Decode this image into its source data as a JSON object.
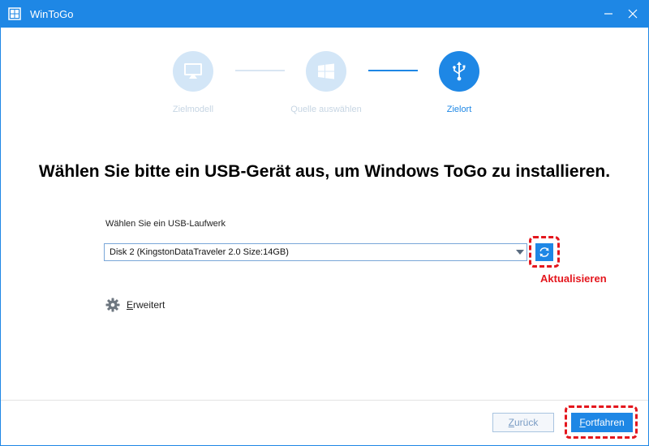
{
  "window": {
    "title": "WinToGo",
    "icon": "app-grid-icon",
    "minimize_icon": "minimize-icon",
    "close_icon": "close-icon"
  },
  "steps": [
    {
      "label": "Zielmodell",
      "icon": "monitor-icon",
      "state": "done"
    },
    {
      "label": "Quelle auswählen",
      "icon": "windows-logo-icon",
      "state": "done"
    },
    {
      "label": "Zielort",
      "icon": "usb-icon",
      "state": "active"
    }
  ],
  "main": {
    "heading": "Wählen Sie bitte ein USB-Gerät aus, um Windows ToGo zu installieren.",
    "field_label": "Wählen Sie ein USB-Laufwerk",
    "selected_drive": "Disk 2 (KingstonDataTraveler 2.0 Size:14GB)",
    "refresh_icon": "refresh-icon",
    "refresh_callout": "Aktualisieren",
    "advanced_label": "Erweitert",
    "advanced_icon": "gear-icon"
  },
  "footer": {
    "back_label": "Zurück",
    "next_label": "Fortfahren"
  },
  "colors": {
    "accent": "#1e87e5",
    "highlight": "#e4161d",
    "step_done": "#d3e6f7"
  }
}
